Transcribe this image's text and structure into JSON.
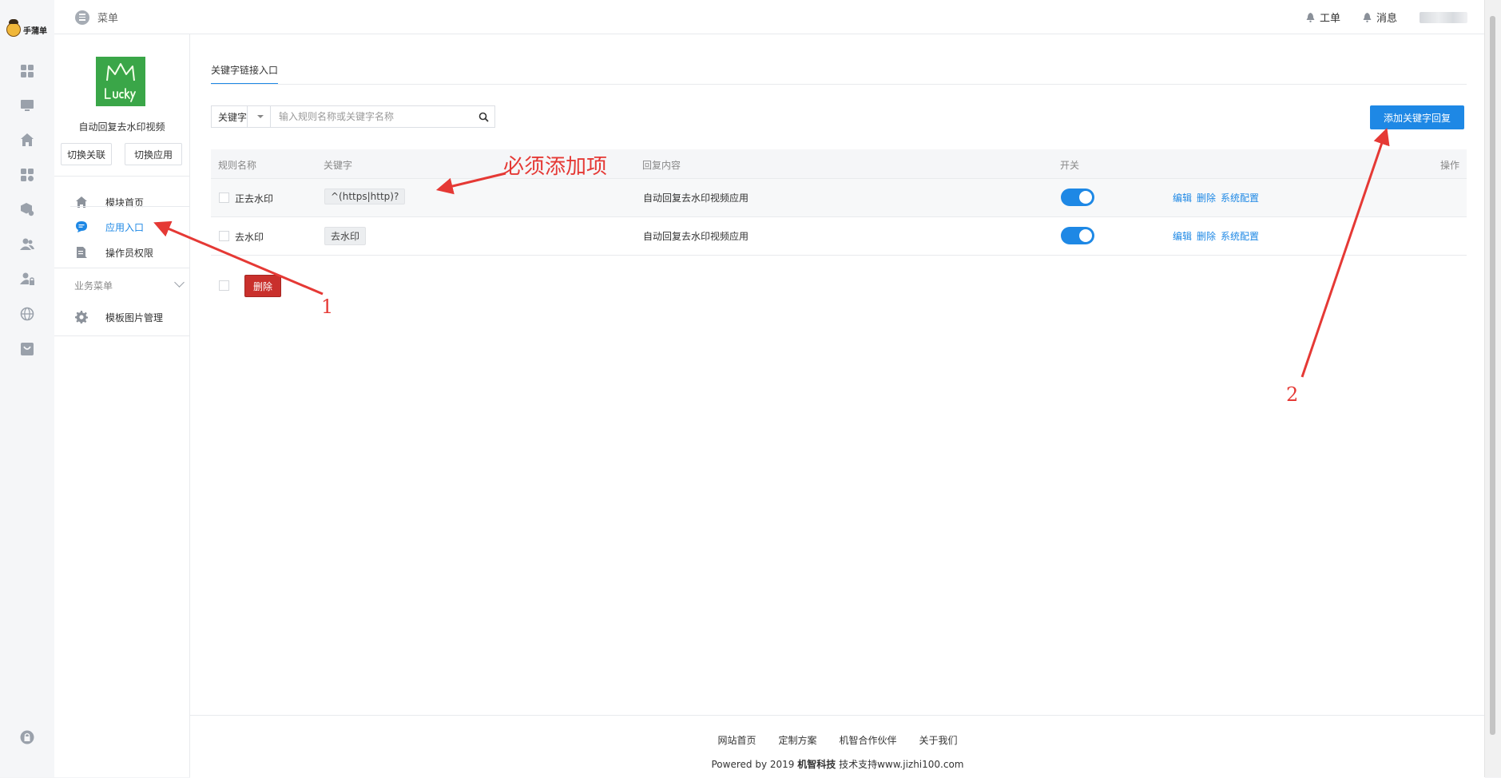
{
  "brand": {
    "logo_text": "手蒲单"
  },
  "header": {
    "menu_label": "菜单",
    "work_order_label": "工单",
    "message_label": "消息"
  },
  "rail": {
    "icons": [
      "dashboard-icon",
      "monitor-icon",
      "home-icon",
      "apps-settings-icon",
      "cube-settings-icon",
      "users-icon",
      "user-lock-icon",
      "globe-icon",
      "bag-icon"
    ],
    "bottom_icon": "lock-icon"
  },
  "sidebar": {
    "app_name": "自动回复去水印视频",
    "switch_link_label": "切换关联",
    "switch_app_label": "切换应用",
    "items": [
      {
        "label": "模块首页",
        "icon": "home-icon",
        "active": false
      },
      {
        "label": "应用入口",
        "icon": "chat-icon",
        "active": true
      },
      {
        "label": "操作员权限",
        "icon": "document-icon",
        "active": false
      }
    ],
    "section_title": "业务菜单",
    "section_items": [
      {
        "label": "模板图片管理",
        "icon": "gear-icon"
      }
    ]
  },
  "main": {
    "tab_label": "关键字链接入口",
    "filter": {
      "select_value": "关键字",
      "placeholder": "输入规则名称或关键字名称"
    },
    "add_button_label": "添加关键字回复",
    "columns": [
      "规则名称",
      "关键字",
      "回复内容",
      "开关",
      "操作"
    ],
    "rows": [
      {
        "name": "正去水印",
        "keyword": "^(https|http)?",
        "reply": "自动回复去水印视频应用",
        "enabled": true
      },
      {
        "name": "去水印",
        "keyword": "去水印",
        "reply": "自动回复去水印视频应用",
        "enabled": true
      }
    ],
    "row_actions": [
      "编辑",
      "删除",
      "系统配置"
    ],
    "bulk_delete_label": "删除"
  },
  "footer": {
    "links": [
      "网站首页",
      "定制方案",
      "机智合作伙伴",
      "关于我们"
    ],
    "copyright_prefix": "Powered by 2019",
    "copyright_brand": "机智科技",
    "copyright_suffix": "技术支持www.jizhi100.com"
  },
  "annotations": {
    "required_label": "必须添加项",
    "marker_1": "1",
    "marker_2": "2",
    "color": "#e53935"
  },
  "colors": {
    "primary": "#1e88e5",
    "danger": "#c9302c",
    "app_logo_bg": "#3aa648"
  }
}
